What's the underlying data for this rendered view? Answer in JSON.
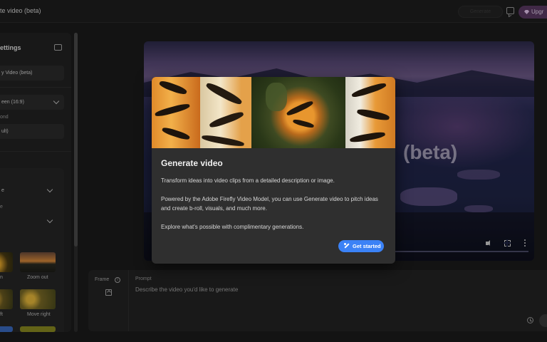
{
  "topbar": {
    "title": "te video (beta)",
    "disabled_button": "Generate",
    "upgrade_label": "Upgr"
  },
  "left_panel": {
    "title": "ettings",
    "model_value": "y Video (beta)",
    "aspect_value": "een (16:9)",
    "fps_label": "ond",
    "fps_value": "ult)",
    "camera_value": "e",
    "angle_label": "e",
    "angle_value": "",
    "motions": [
      {
        "label": "n"
      },
      {
        "label": "Zoom out"
      },
      {
        "label": "ft"
      },
      {
        "label": "Move right"
      }
    ]
  },
  "preview": {
    "overlay_text": "(beta)"
  },
  "prompt": {
    "frame_label": "Frame",
    "info_glyph": "i",
    "prompt_label": "Prompt",
    "placeholder": "Describe the video you'd like to generate"
  },
  "modal": {
    "title": "Generate video",
    "paragraph1": "Transform ideas into video clips from a detailed description or image.",
    "paragraph2": "Powered by the Adobe Firefly Video Model, you can use Generate video to pitch ideas and create b-roll, visuals, and much more.",
    "paragraph3": "Explore what's possible with complimentary generations.",
    "cta_label": "Get started"
  },
  "colors": {
    "accent": "#3b82f6",
    "upgrade": "#5a3a63",
    "modal_bg": "#2f2f2f"
  }
}
